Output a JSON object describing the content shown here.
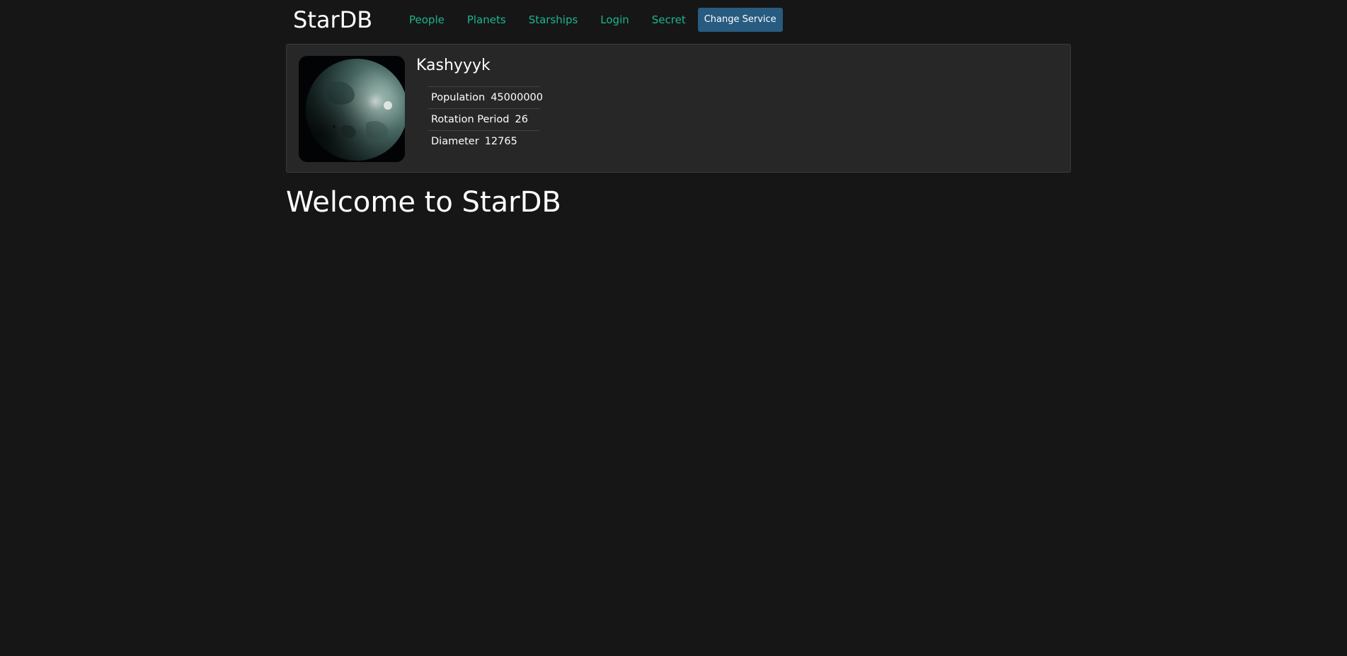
{
  "header": {
    "logo": "StarDB",
    "nav": {
      "people": "People",
      "planets": "Planets",
      "starships": "Starships",
      "login": "Login",
      "secret": "Secret"
    },
    "change_service": "Change Service"
  },
  "planet": {
    "name": "Kashyyyk",
    "image_icon": "planet-image",
    "details": [
      {
        "term": "Population",
        "value": "45000000"
      },
      {
        "term": "Rotation Period",
        "value": "26"
      },
      {
        "term": "Diameter",
        "value": "12765"
      }
    ]
  },
  "main": {
    "welcome": "Welcome to StarDB"
  },
  "colors": {
    "background": "#161616",
    "card": "#272727",
    "link": "#1bb58f",
    "button": "#285b80"
  }
}
